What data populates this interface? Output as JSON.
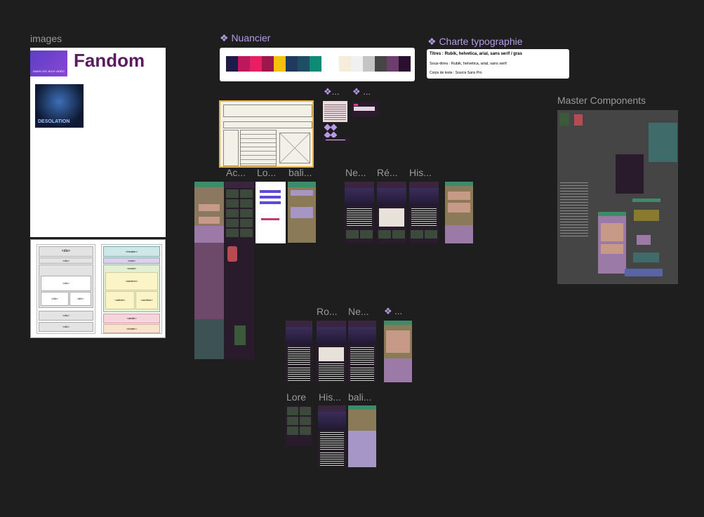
{
  "canvas": {
    "background": "#1e1e1e"
  },
  "sections": {
    "images": "images",
    "nuancier": "❖ Nuancier",
    "typo": "❖ Charte typographie",
    "master": "Master Components"
  },
  "nuancier": {
    "colors": [
      "#1e1b4b",
      "#be185d",
      "#e91e63",
      "#9d174d",
      "#f4c20d",
      "#1e3a5f",
      "#1d4e63",
      "#0f8a76",
      "#ffffff",
      "#f5ecd9",
      "#f0f0f0",
      "#c4c4c4",
      "#454545",
      "#6b3e6b",
      "#2a0f30"
    ]
  },
  "typo": {
    "titles": "Titres : Rubik, helvetica, arial, sans serif / gras",
    "subtitles": "Sous-titres : Rubik, helvetica, arial, sans serif",
    "body": "Corps de texte : Source Sans Pro"
  },
  "images_frame": {
    "logo": "Fandom",
    "banner_text": "DANS LES JEUX VIDÉO",
    "game_title": "DESOLATION"
  },
  "frame_labels": {
    "ac": "Ac...",
    "lo": "Lo...",
    "bali1": "bali...",
    "ne1": "Ne...",
    "re": "Ré...",
    "his1": "His...",
    "ro": "Ro...",
    "ne2": "Ne...",
    "comp2": "❖ ...",
    "lore": "Lore",
    "his2": "His...",
    "bali2": "bali...",
    "comp1a": "❖...",
    "comp1b": "❖ ..."
  },
  "wireframe": {
    "tags": [
      "<div>",
      "<div>",
      "<div>",
      "<div>",
      "<div>",
      "<div>",
      "<div>"
    ],
    "semantic": [
      "<header>",
      "<nav>",
      "<main>",
      "<section>",
      "<article>",
      "<section>",
      "<aside>",
      "<footer>"
    ]
  }
}
